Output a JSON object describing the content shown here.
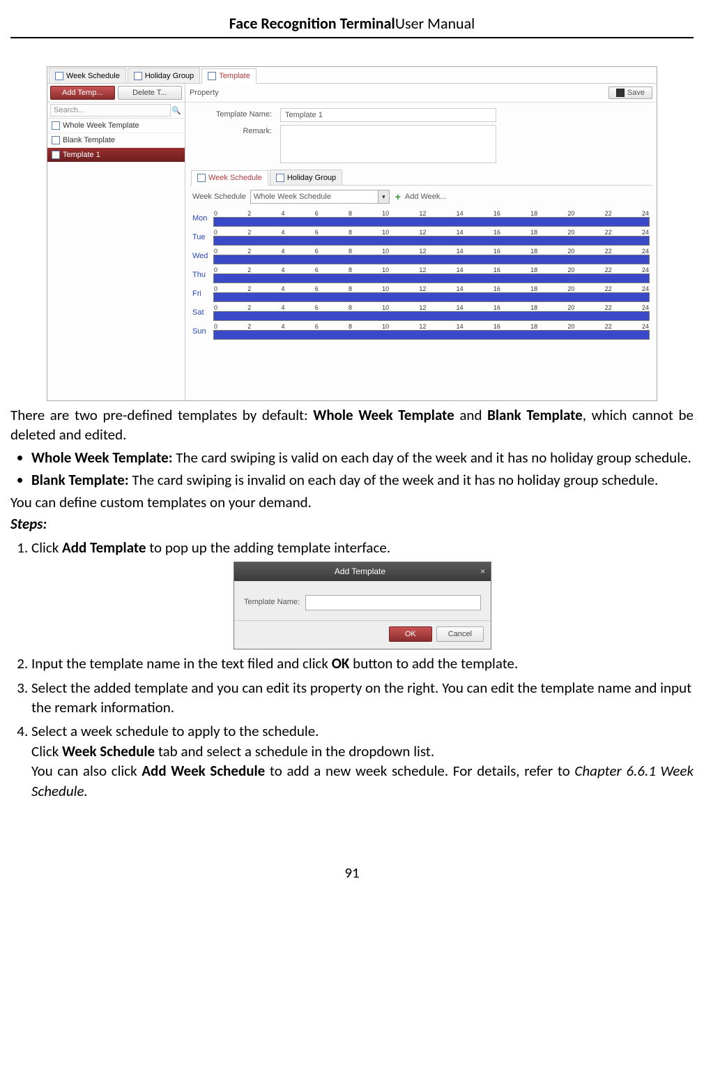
{
  "header": {
    "title_bold": "Face Recognition Terminal",
    "title_rest": "  User Manual"
  },
  "screenshot": {
    "top_tabs": {
      "week_schedule": "Week Schedule",
      "holiday_group": "Holiday Group",
      "template": "Template"
    },
    "left_buttons": {
      "add": "Add Temp...",
      "delete": "Delete T..."
    },
    "search": {
      "placeholder": "Search..."
    },
    "left_list": {
      "item0": "Whole Week Template",
      "item1": "Blank Template",
      "item2": "Template 1"
    },
    "property_label": "Property",
    "save_label": "Save",
    "form": {
      "template_name_label": "Template Name:",
      "template_name_value": "Template 1",
      "remark_label": "Remark:"
    },
    "sub_tabs": {
      "week_schedule": "Week Schedule",
      "holiday_group": "Holiday Group"
    },
    "ws_row": {
      "label": "Week Schedule",
      "dropdown_value": "Whole Week Schedule",
      "add_week": "Add Week..."
    },
    "days": {
      "d0": "Mon",
      "d1": "Tue",
      "d2": "Wed",
      "d3": "Thu",
      "d4": "Fri",
      "d5": "Sat",
      "d6": "Sun"
    },
    "ticks": {
      "t0": "0",
      "t1": "2",
      "t2": "4",
      "t3": "6",
      "t4": "8",
      "t5": "10",
      "t6": "12",
      "t7": "14",
      "t8": "16",
      "t9": "18",
      "t10": "20",
      "t11": "22",
      "t12": "24"
    }
  },
  "body": {
    "p1a": "There are two pre-defined templates by default: ",
    "p1b": "Whole Week Template",
    "p1c": " and ",
    "p1d": "Blank Template",
    "p1e": ", which cannot be deleted and edited.",
    "bullet1a": "Whole Week Template:",
    "bullet1b": " The card swiping is valid on each day of the week and it has no holiday group schedule.",
    "bullet2a": "Blank Template:",
    "bullet2b": " The card swiping is invalid on each day of the week and it has no holiday group schedule.",
    "p2": "You can define custom templates on your demand.",
    "steps_label": "Steps:",
    "step1a": "Click ",
    "step1b": "Add Template",
    "step1c": " to pop up the adding template interface.",
    "step2a": "Input the template name in the text filed and click ",
    "step2b": "OK",
    "step2c": " button to add the template.",
    "step3": "Select the added template and you can edit its property on the right. You can edit the template name and input the remark information.",
    "step4": "Select a week schedule to apply to the schedule.",
    "step4sub1a": "Click ",
    "step4sub1b": "Week Schedule",
    "step4sub1c": " tab and select a schedule in the dropdown list.",
    "step4sub2a": "You can also click ",
    "step4sub2b": "Add Week Schedule",
    "step4sub2c": " to add a new week schedule. For details, refer to ",
    "step4sub2d": "Chapter 6.6.1 Week Schedule."
  },
  "dialog": {
    "title": "Add Template",
    "close": "×",
    "label": "Template Name:",
    "ok": "OK",
    "cancel": "Cancel"
  },
  "page_number": "91"
}
